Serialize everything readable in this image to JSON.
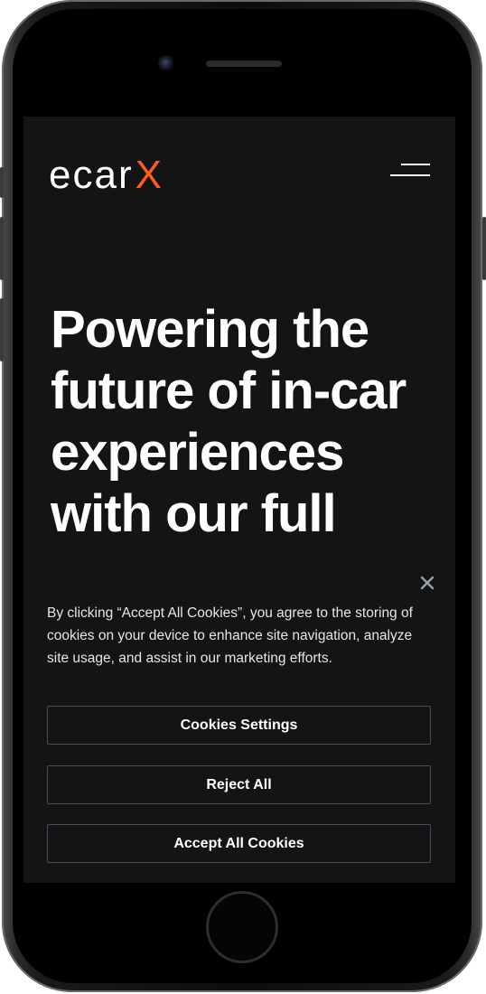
{
  "header": {
    "logo_main": "ecar",
    "logo_accent": "X",
    "menu_icon": "hamburger-menu-icon"
  },
  "hero": {
    "title": "Powering the future of in-car experiences with our full"
  },
  "cookie_banner": {
    "close_icon": "close-icon",
    "text": "By clicking “Accept All Cookies”, you agree to the storing of cookies on your device to enhance site navigation, analyze site usage, and assist in our marketing efforts.",
    "settings_label": "Cookies Settings",
    "reject_label": "Reject All",
    "accept_label": "Accept All Cookies"
  },
  "colors": {
    "background": "#121416",
    "accent": "#ff5a1f",
    "text": "#ffffff",
    "button_border": "#4a4d52"
  }
}
